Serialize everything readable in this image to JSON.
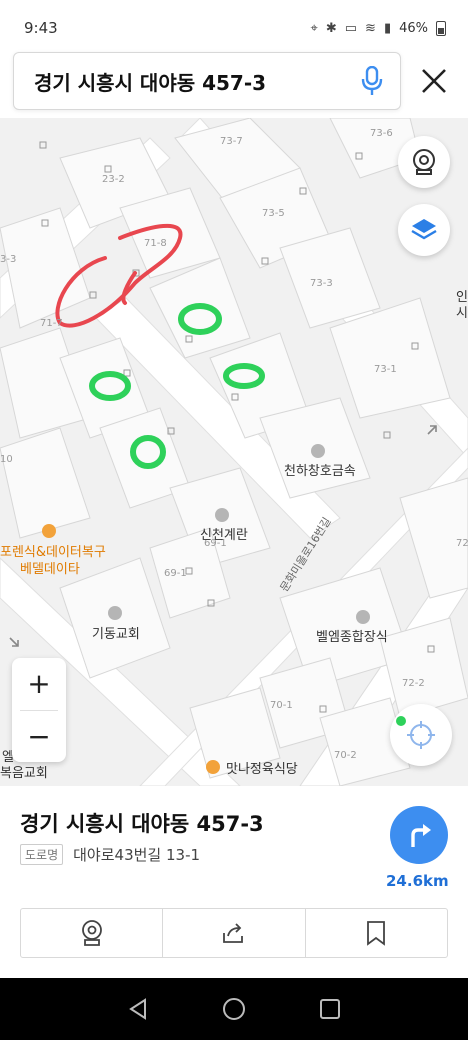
{
  "status_bar": {
    "time": "9:43",
    "battery": "46%"
  },
  "search": {
    "query": "경기 시흥시 대야동 457-3"
  },
  "map": {
    "lot_numbers": [
      "73-7",
      "73-6",
      "23-2",
      "73-5",
      "71-8",
      "3-3",
      "73-3",
      "71-7",
      "73-1",
      "10",
      "69-1",
      "72",
      "72-2",
      "70-1",
      "70-2"
    ],
    "places": {
      "cheonha": "천하창호금속",
      "sincheon": "신천계란",
      "forensic_line1": "포렌식&데이터복구",
      "forensic_line2": "베델데이타",
      "gidong": "기동교회",
      "belem": "벨엠종합장식",
      "matna": "맛나정육식당",
      "left_line1": "엘",
      "left_line2": "복음교회",
      "right_edge": "인\n시"
    },
    "road": "문화미을로16번길"
  },
  "controls": {
    "zoom_in": "+",
    "zoom_out": "−"
  },
  "sheet": {
    "title": "경기 시흥시 대야동 457-3",
    "road_tag": "도로명",
    "road_address": "대야로43번길 13-1",
    "distance": "24.6km"
  },
  "colors": {
    "accent_blue": "#3d8ef0",
    "marker_red": "#e8474f",
    "marker_green": "#2ed15a"
  }
}
